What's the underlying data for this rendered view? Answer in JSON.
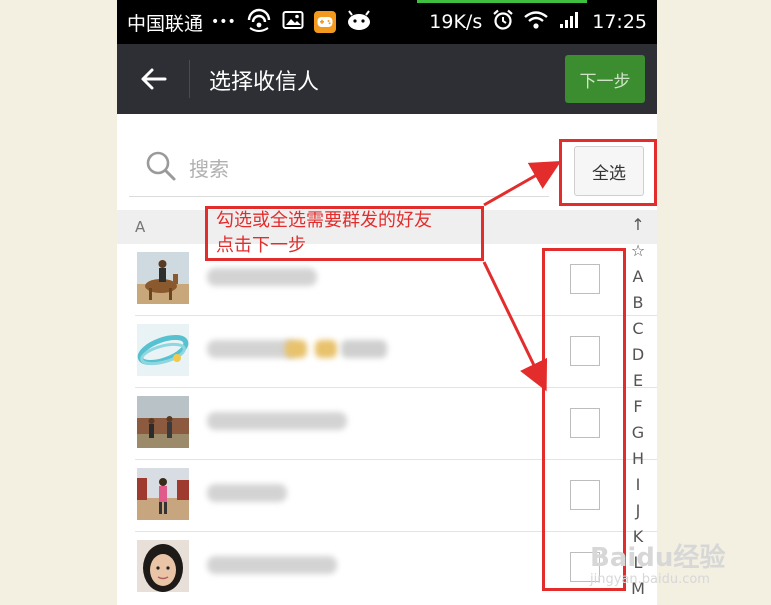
{
  "status_bar": {
    "carrier": "中国联通",
    "dots": "•••",
    "net_speed": "19K/s",
    "time": "17:25"
  },
  "header": {
    "title": "选择收信人",
    "next_label": "下一步"
  },
  "search": {
    "placeholder": "搜索",
    "select_all_label": "全选"
  },
  "section": {
    "letter": "A"
  },
  "contacts": [
    {
      "avatar": "avatar-camel-rider"
    },
    {
      "avatar": "avatar-blue-bracelet"
    },
    {
      "avatar": "avatar-ruins-people"
    },
    {
      "avatar": "avatar-woman-standing"
    },
    {
      "avatar": "avatar-woman-face"
    }
  ],
  "index_bar": [
    "↑",
    "☆",
    "A",
    "B",
    "C",
    "D",
    "E",
    "F",
    "G",
    "H",
    "I",
    "J",
    "K",
    "L",
    "M"
  ],
  "annotation": {
    "line1": "勾选或全选需要群发的好友",
    "line2": "点击下一步"
  },
  "watermark": {
    "text": "Baidu经验",
    "url": "jingyan.baidu.com"
  },
  "colors": {
    "title_bar": "#2d2f34",
    "next_button": "#3c8d2f",
    "annotation_red": "#e32d2d"
  }
}
